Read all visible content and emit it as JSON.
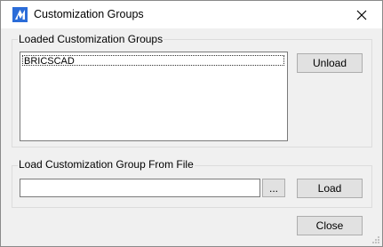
{
  "window": {
    "title": "Customization Groups"
  },
  "loaded_group": {
    "label": "Loaded Customization Groups",
    "items": [
      "BRICSCAD"
    ],
    "unload_label": "Unload"
  },
  "load_group": {
    "label": "Load Customization Group From File",
    "file_path_value": "",
    "browse_label": "...",
    "load_label": "Load"
  },
  "footer": {
    "close_label": "Close"
  },
  "colors": {
    "accent": "#2b6cd8",
    "window_bg": "#f0f0f0",
    "button_bg": "#e1e1e1"
  }
}
